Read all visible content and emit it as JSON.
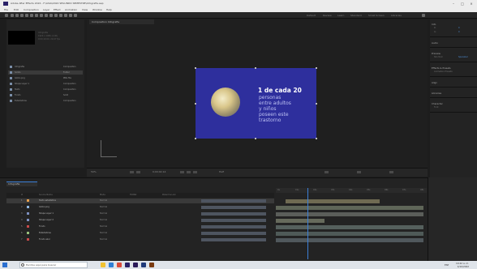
{
  "window": {
    "title": "Adobe After Effects 2022 - F:\\ASIA\\2022 SEGUNDO SEMESTRE\\Infografia.aep",
    "controls": [
      "minimize",
      "maximize",
      "close"
    ],
    "logo_color": "#2a2168"
  },
  "menu": [
    "File",
    "Edit",
    "Composition",
    "Layer",
    "Effect",
    "Animation",
    "View",
    "Window",
    "Help"
  ],
  "workspace": [
    "Default",
    "Review",
    "Learn",
    "Standard",
    "Small Screen",
    "Libraries"
  ],
  "project": {
    "meta_lines": [
      "Infografia",
      "1920 x 1080 (1,00)",
      "0;00;10;00, 29,97 fps"
    ],
    "items": [
      {
        "name": "Infografia",
        "type": "Composition",
        "selected": false
      },
      {
        "name": "Solids",
        "type": "Folder",
        "selected": true
      },
      {
        "name": "Globo.png",
        "type": "PNG file",
        "selected": false
      },
      {
        "name": "Shape Layer 1",
        "type": "Composition",
        "selected": false
      },
      {
        "name": "Texto",
        "type": "Composition",
        "selected": false
      },
      {
        "name": "Fondo",
        "type": "Solid",
        "selected": false
      },
      {
        "name": "Estadisticas",
        "type": "Composition",
        "selected": false
      }
    ]
  },
  "viewer": {
    "tab_label": "Composition Infografia",
    "canvas_color": "#2e2f9d",
    "statistic": {
      "headline": "1 de cada 20",
      "lines": [
        "personas",
        "entre adultos",
        "y niños",
        "poseen este",
        "trastorno"
      ]
    },
    "footer": {
      "zoom": "50%",
      "timecode": "0;00;02;14",
      "resolution": "Half"
    }
  },
  "right_panel": {
    "sections": [
      {
        "title": "Info",
        "rows": [
          {
            "label": "R:",
            "value": "0"
          },
          {
            "label": "G:",
            "value": "0"
          }
        ]
      },
      {
        "title": "Audio",
        "rows": []
      },
      {
        "title": "Preview",
        "rows": [
          {
            "label": "Shortcut",
            "value": "Spacebar"
          }
        ]
      },
      {
        "title": "Effects & Presets",
        "rows": [
          {
            "label": "Animation Presets",
            "value": ""
          }
        ]
      },
      {
        "title": "Align",
        "rows": []
      },
      {
        "title": "Libraries",
        "rows": []
      },
      {
        "title": "Character",
        "rows": [
          {
            "label": "Font",
            "value": ""
          }
        ]
      }
    ]
  },
  "timeline": {
    "tab_label": "Infografia",
    "columns": [
      "#",
      "Source Name",
      "Mode",
      "TrkMat",
      "Parent & Link"
    ],
    "ruler_ticks": [
      "0s",
      "01s",
      "02s",
      "03s",
      "04s",
      "05s",
      "06s",
      "07s",
      "08s"
    ],
    "layers": [
      {
        "num": "1",
        "name": "Texto estadistica",
        "mode": "Normal",
        "color": "#e6a04e",
        "selected": true
      },
      {
        "num": "2",
        "name": "Globo.png",
        "mode": "Normal",
        "color": "#8fb7e0",
        "selected": false
      },
      {
        "num": "3",
        "name": "Shape Layer 1",
        "mode": "Normal",
        "color": "#7c8fbf",
        "selected": false
      },
      {
        "num": "4",
        "name": "Shape Layer 2",
        "mode": "Normal",
        "color": "#7c8fbf",
        "selected": false
      },
      {
        "num": "5",
        "name": "Fondo",
        "mode": "Normal",
        "color": "#c64a4a",
        "selected": false
      },
      {
        "num": "6",
        "name": "Estadisticas",
        "mode": "Normal",
        "color": "#98c07c",
        "selected": false
      },
      {
        "num": "7",
        "name": "Fondo azul",
        "mode": "Normal",
        "color": "#c64a4a",
        "selected": false
      }
    ],
    "bar_colors": [
      "#6f6a52",
      "#5f6658",
      "#5b5e5a",
      "#666a5c",
      "#55605d",
      "#4f5a58",
      "#50585c"
    ]
  },
  "taskbar": {
    "search_placeholder": "Escribe aquí para buscar",
    "apps": [
      "file-explorer-icon",
      "edge-icon",
      "chrome-icon",
      "after-effects-icon",
      "premiere-icon",
      "photoshop-icon",
      "illustrator-icon"
    ],
    "app_colors": [
      "#f1c232",
      "#2f7fd6",
      "#d94a3a",
      "#2a2168",
      "#2b1a59",
      "#1f3a7a",
      "#7a3a10"
    ],
    "language": "ESP",
    "time": "10:42 a. m.",
    "date": "4/10/2022"
  }
}
